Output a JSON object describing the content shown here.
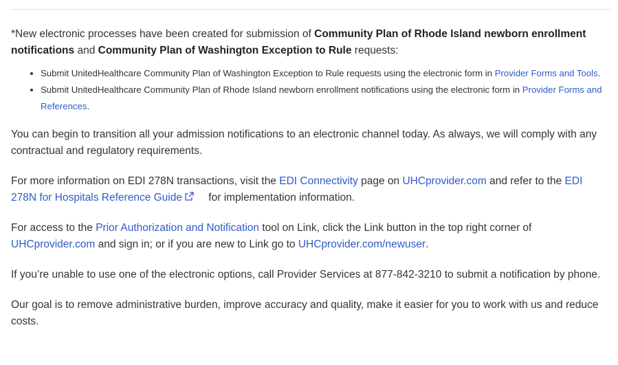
{
  "intro": {
    "prefix": "*New electronic processes have been created for submission of ",
    "bold1": "Community Plan of Rhode Island newborn enrollment notifications",
    "mid": " and ",
    "bold2": "Community Plan of Washington Exception to Rule",
    "suffix": " requests:"
  },
  "bullets": [
    {
      "text": "Submit UnitedHealthcare Community Plan of Washington Exception to Rule requests using the electronic form in ",
      "link": "Provider Forms and Tools",
      "end": "."
    },
    {
      "text": "Submit UnitedHealthcare Community Plan of Rhode Island newborn enrollment notifications using the electronic form in ",
      "link": "Provider Forms and References",
      "end": "."
    }
  ],
  "para_transition": "You can begin to transition all your admission notifications to an electronic channel today. As always, we will comply with any contractual and regulatory requirements.",
  "para_edi": {
    "t1": "For more information on EDI 278N transactions, visit the ",
    "link1": "EDI Connectivity",
    "t2": " page on ",
    "link2": "UHCprovider.com",
    "t3": " and refer to the ",
    "link3": "EDI 278N for Hospitals Reference Guide",
    "t4": " for implementation information."
  },
  "para_prior": {
    "t1": "For access to the ",
    "link1": "Prior Authorization and Notification",
    "t2": " tool on Link, click the Link button in the top right corner of ",
    "link2": "UHCprovider.com",
    "t3": " and sign in; or if you are new to Link go to ",
    "link3": "UHCprovider.com/newuser",
    "t4": "."
  },
  "para_phone": "If you’re unable to use one of the electronic options, call Provider Services at 877-842-3210 to submit a notification by phone.",
  "para_goal": "Our goal is to remove administrative burden, improve accuracy and quality, make it easier for you to work with us and reduce costs.",
  "colors": {
    "link": "#2f5bc4",
    "text": "#333333",
    "divider": "#dedede"
  },
  "icons": {
    "external_link": "external-link-icon"
  }
}
